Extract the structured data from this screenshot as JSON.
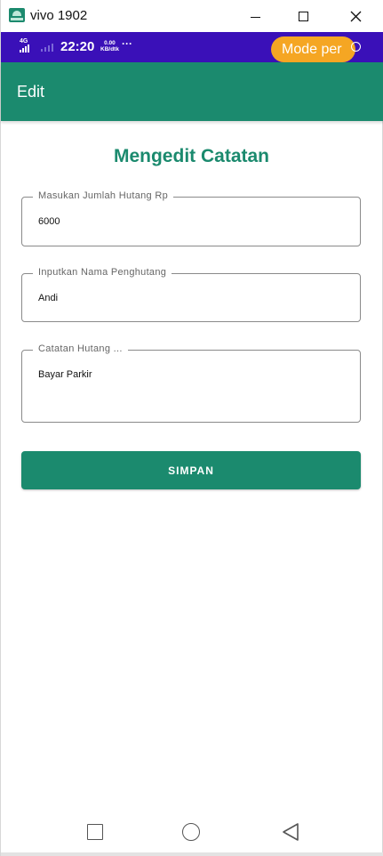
{
  "window": {
    "title": "vivo 1902"
  },
  "statusbar": {
    "network": "4G",
    "time": "22:20",
    "speed_value": "0.00",
    "speed_unit": "KB/dtk",
    "more": "···",
    "mode_badge": "Mode per"
  },
  "appbar": {
    "title": "Edit"
  },
  "form": {
    "heading": "Mengedit Catatan",
    "amount": {
      "label": "Masukan Jumlah Hutang Rp",
      "value": "6000"
    },
    "debtor": {
      "label": "Inputkan Nama Penghutang",
      "value": "Andi"
    },
    "note": {
      "label": "Catatan Hutang ...",
      "value": "Bayar Parkir"
    },
    "save_label": "SIMPAN"
  },
  "colors": {
    "primary": "#1b8a6e",
    "statusbar": "#3a10b8",
    "badge": "#f5a623"
  }
}
